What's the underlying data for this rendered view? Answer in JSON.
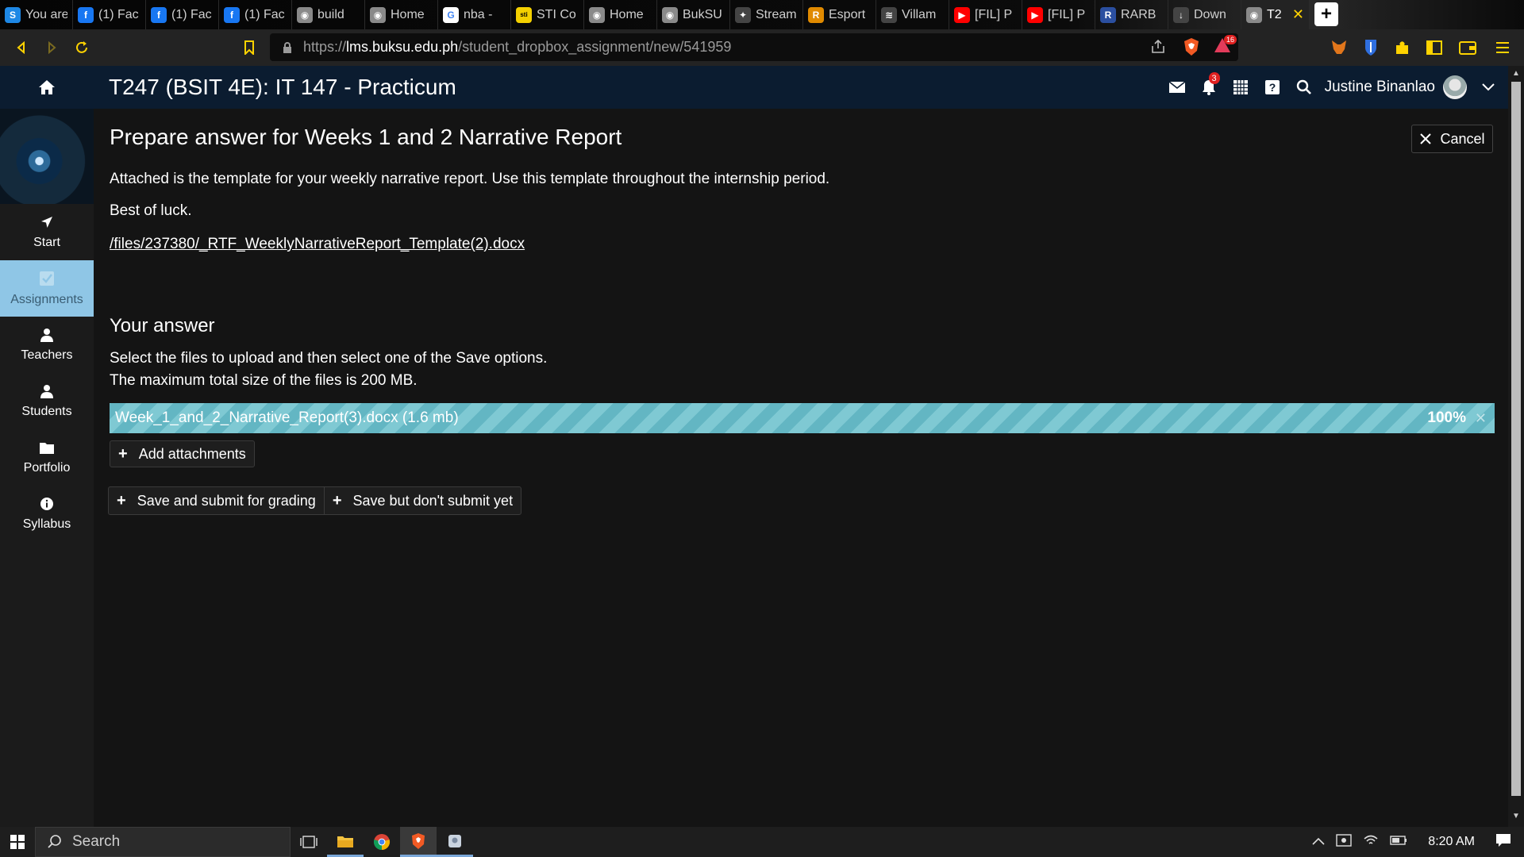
{
  "browser": {
    "tabs": [
      {
        "title": "You are",
        "icon": "s-icon",
        "color": "#1e88e5",
        "glyph": "S"
      },
      {
        "title": "(1) Fac",
        "icon": "facebook-icon",
        "color": "#1877f2",
        "glyph": "f"
      },
      {
        "title": "(1) Fac",
        "icon": "facebook-icon",
        "color": "#1877f2",
        "glyph": "f"
      },
      {
        "title": "(1) Fac",
        "icon": "facebook-icon",
        "color": "#1877f2",
        "glyph": "f"
      },
      {
        "title": "build",
        "icon": "buksu-icon",
        "color": "#8a8a8a",
        "glyph": "◉"
      },
      {
        "title": "Home",
        "icon": "buksu-icon",
        "color": "#8a8a8a",
        "glyph": "◉"
      },
      {
        "title": "nba -",
        "icon": "google-icon",
        "color": "#ffffff",
        "glyph": "G"
      },
      {
        "title": "STI Co",
        "icon": "sti-icon",
        "color": "#f4d000",
        "glyph": "sti"
      },
      {
        "title": "Home",
        "icon": "buksu-icon",
        "color": "#8a8a8a",
        "glyph": "◉"
      },
      {
        "title": "BukSU",
        "icon": "buksu-icon",
        "color": "#8a8a8a",
        "glyph": "◉"
      },
      {
        "title": "Stream",
        "icon": "stream-icon",
        "color": "#444444",
        "glyph": "✦"
      },
      {
        "title": "Esport",
        "icon": "esports-icon",
        "color": "#e08a00",
        "glyph": "R"
      },
      {
        "title": "Villam",
        "icon": "wifi-icon",
        "color": "#444444",
        "glyph": "≋"
      },
      {
        "title": "[FIL] P",
        "icon": "youtube-icon",
        "color": "#ff0000",
        "glyph": "▶"
      },
      {
        "title": "[FIL] P",
        "icon": "youtube-icon",
        "color": "#ff0000",
        "glyph": "▶"
      },
      {
        "title": "RARB",
        "icon": "rarbg-icon",
        "color": "#2b4fa0",
        "glyph": "R"
      },
      {
        "title": "Down",
        "icon": "download-icon",
        "color": "#444444",
        "glyph": "↓"
      }
    ],
    "active_tab": {
      "title": "T2",
      "icon": "buksu-icon"
    },
    "url_prefix": "https://",
    "url_host": "lms.buksu.edu.ph",
    "url_path": "/student_dropbox_assignment/new/541959",
    "brave_badge": "16"
  },
  "header": {
    "course_title": "T247 (BSIT 4E): IT 147 - Practicum",
    "notif_count": "3",
    "user_name": "Justine Binanlao"
  },
  "sidebar": {
    "items": [
      {
        "label": "Start",
        "icon": "navigation-arrow-icon"
      },
      {
        "label": "Assignments",
        "icon": "assignment-check-icon"
      },
      {
        "label": "Teachers",
        "icon": "person-icon"
      },
      {
        "label": "Students",
        "icon": "person-icon"
      },
      {
        "label": "Portfolio",
        "icon": "folder-icon"
      },
      {
        "label": "Syllabus",
        "icon": "info-icon"
      }
    ]
  },
  "main": {
    "title": "Prepare answer for Weeks 1 and 2 Narrative Report",
    "cancel_label": "Cancel",
    "description": "Attached is the template for your weekly narrative report. Use this template throughout the internship period.",
    "closing": "Best of luck.",
    "attachment_link": "/files/237380/_RTF_WeeklyNarrativeReport_Template(2).docx",
    "answer_heading": "Your answer",
    "instructions_1": "Select the files to upload and then select one of the Save options.",
    "instructions_2": "The maximum total size of the files is 200 MB.",
    "upload": {
      "filename": "Week_1_and_2_Narrative_Report(3).docx (1.6 mb)",
      "percent": "100%",
      "progress": 1.0
    },
    "add_attachments_label": "Add attachments",
    "save_submit_label": "Save and submit for grading",
    "save_nosubmit_label": "Save but don't submit yet"
  },
  "taskbar": {
    "search_placeholder": "Search",
    "time": "8:20 AM"
  },
  "colors": {
    "app_header": "#0b1c30",
    "sidebar_active": "#8fc6e6",
    "progress_stripe": "#7fc9d3",
    "brave_accent": "#ffd300"
  }
}
